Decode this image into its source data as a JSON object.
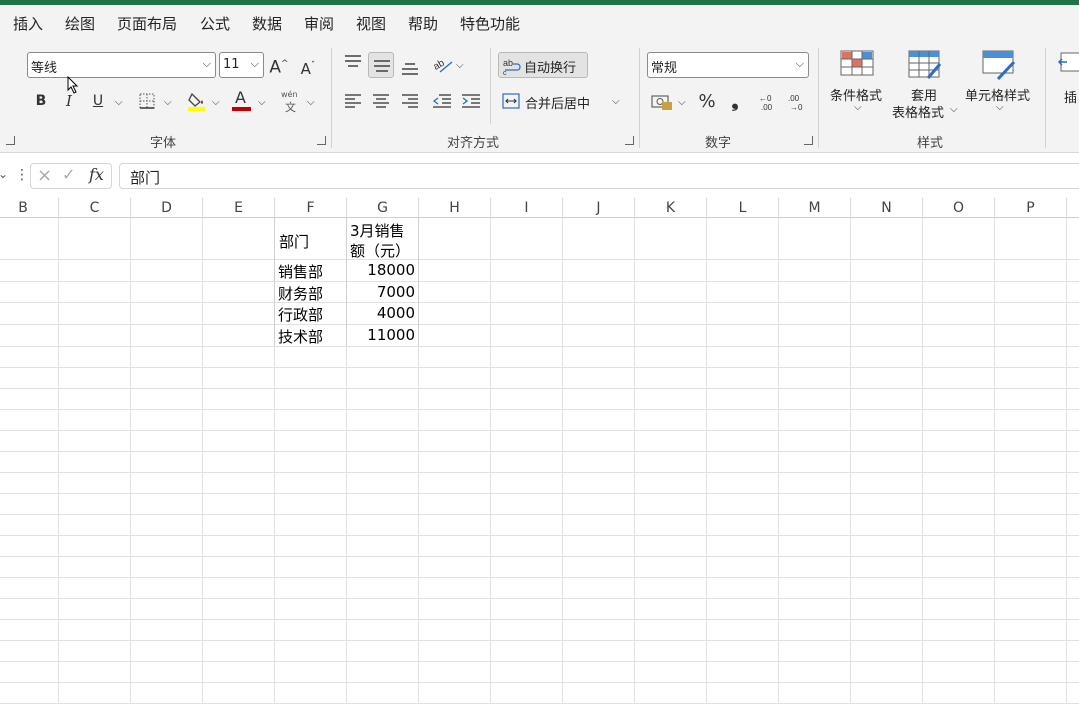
{
  "menu": [
    "插入",
    "绘图",
    "页面布局",
    "公式",
    "数据",
    "审阅",
    "视图",
    "帮助",
    "特色功能"
  ],
  "font": {
    "name": "等线",
    "size": "11",
    "group_label": "字体",
    "bold": "B",
    "italic": "I",
    "underline": "U",
    "font_color_letter": "A",
    "grow": "A",
    "shrink": "A",
    "phonetic_top": "wén",
    "phonetic_bottom": "文"
  },
  "alignment": {
    "wrap_text": "自动换行",
    "merge_center": "合并后居中",
    "group_label": "对齐方式"
  },
  "number": {
    "format": "常规",
    "group_label": "数字"
  },
  "styles": {
    "conditional_format": "条件格式",
    "format_table_line1": "套用",
    "format_table_line2": "表格格式",
    "cell_styles": "单元格样式",
    "group_label": "样式",
    "insert_partial": "插"
  },
  "formula_bar": {
    "value": "部门",
    "fx": "fx"
  },
  "columns": [
    "B",
    "C",
    "D",
    "E",
    "F",
    "G",
    "H",
    "I",
    "J",
    "K",
    "L",
    "M",
    "N",
    "O",
    "P"
  ],
  "table": {
    "header_dept": "部门",
    "header_sales_line1": "3月销售",
    "header_sales_line2": "额（元）",
    "rows": [
      {
        "dept": "销售部",
        "value": "18000"
      },
      {
        "dept": "财务部",
        "value": "7000"
      },
      {
        "dept": "行政部",
        "value": "4000"
      },
      {
        "dept": "技术部",
        "value": "11000"
      }
    ]
  },
  "colors": {
    "accent_green": "#217346",
    "highlight_yellow": "#ffff00",
    "font_red": "#c00000"
  }
}
